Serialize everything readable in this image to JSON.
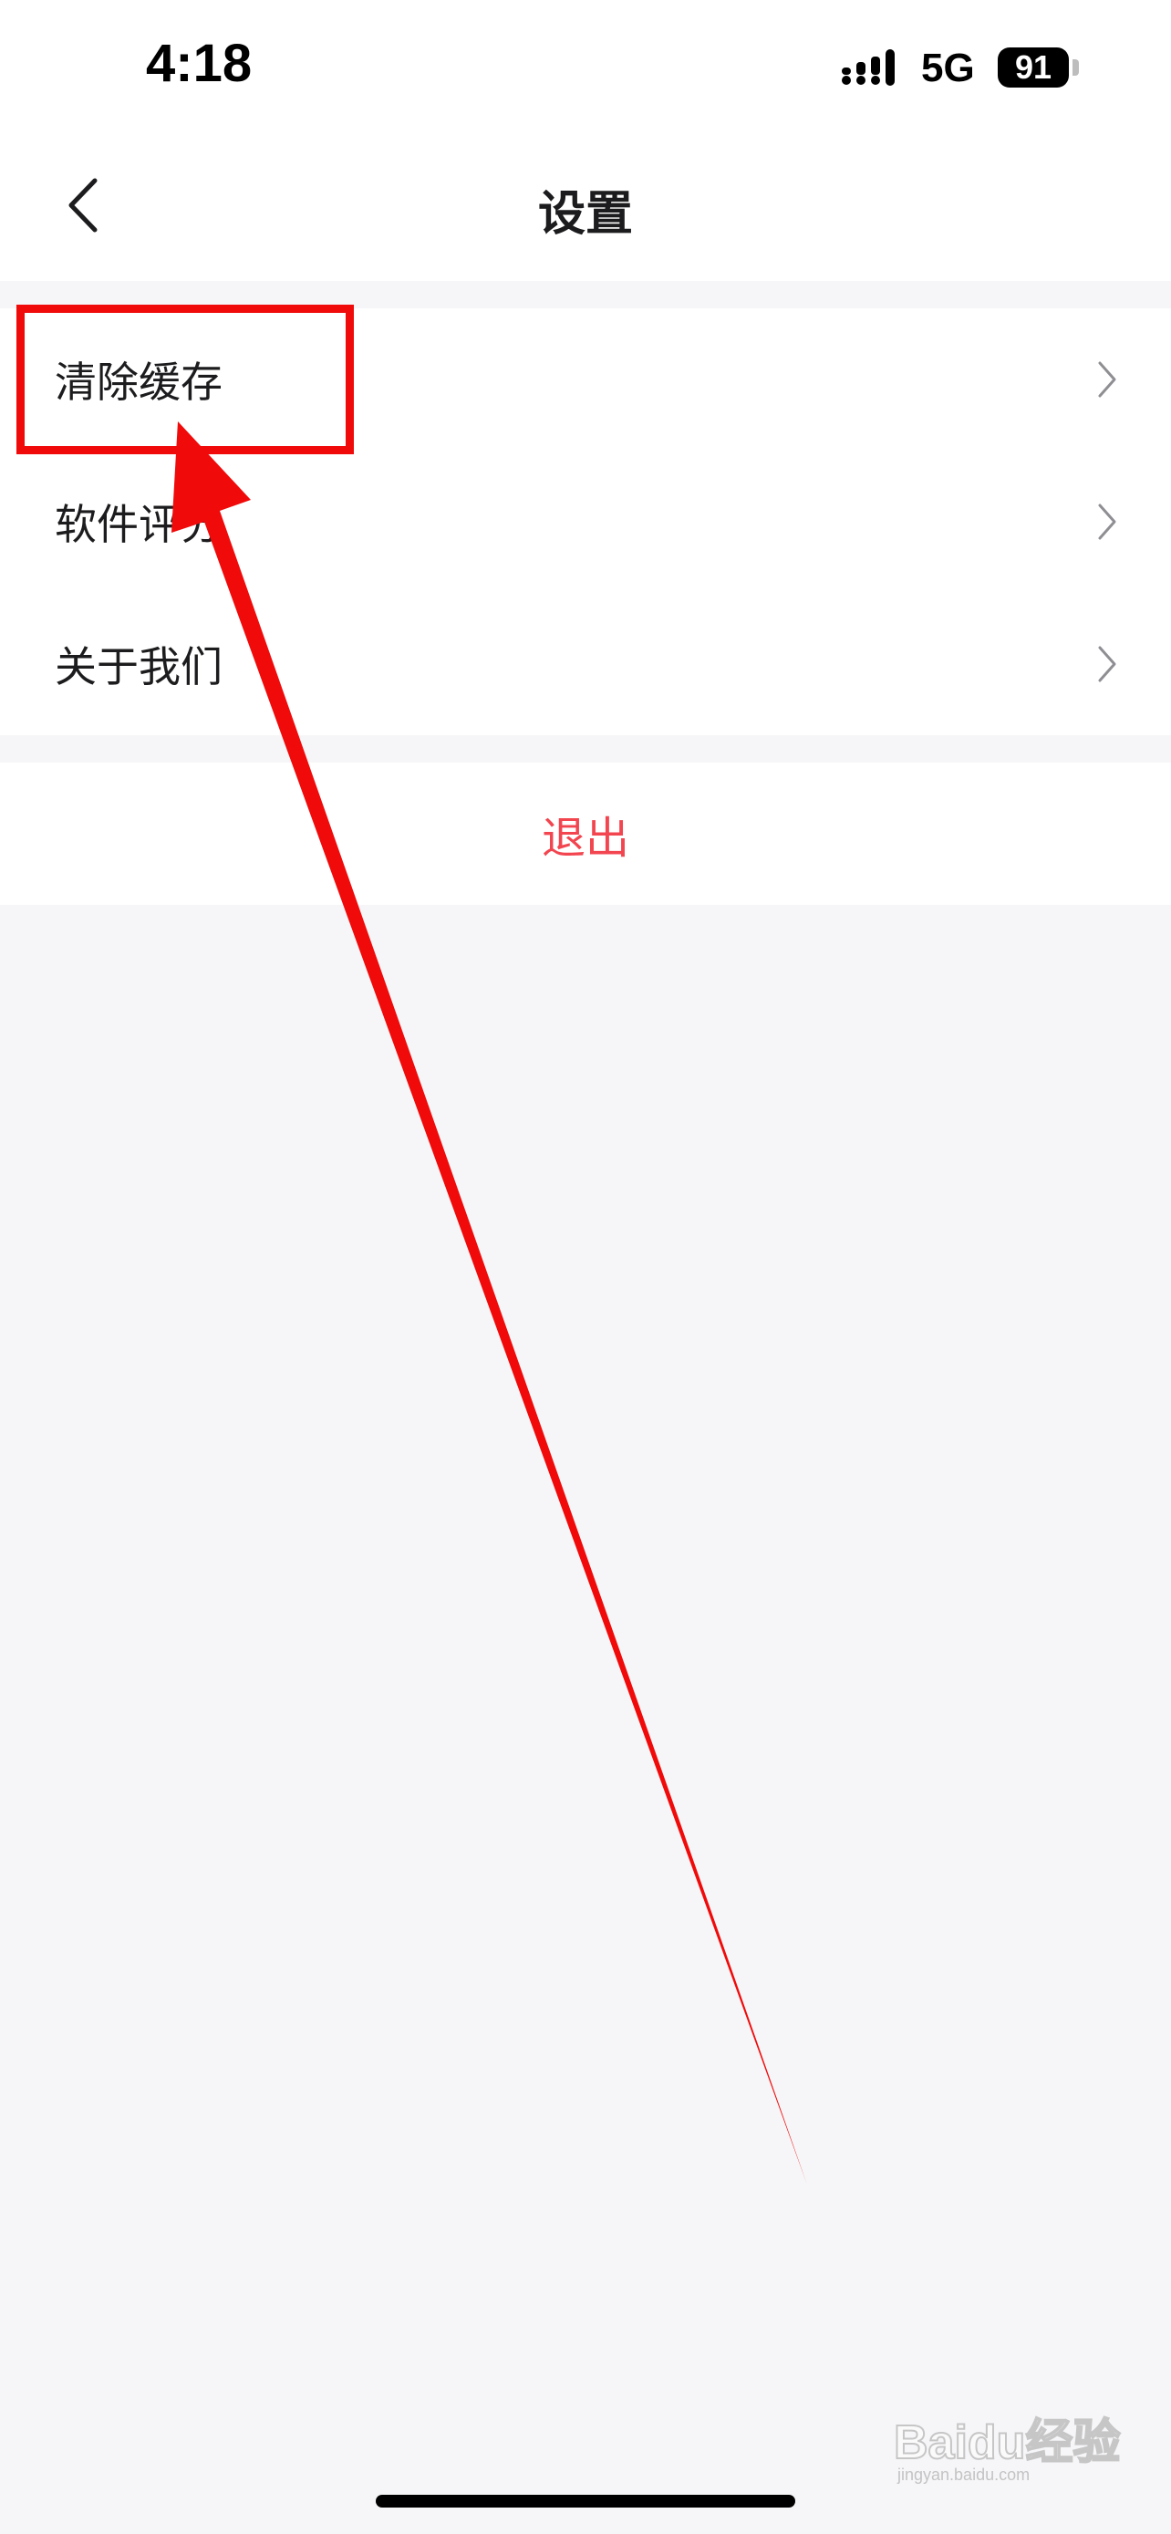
{
  "status_bar": {
    "time": "4:18",
    "network": "5G",
    "battery": "91",
    "signal_icon": "cellular-signal-icon"
  },
  "nav": {
    "back_icon": "chevron-left-icon",
    "title": "设置"
  },
  "settings": {
    "items": [
      {
        "label": "清除缓存",
        "icon": "chevron-right-icon"
      },
      {
        "label": "软件评分",
        "icon": "chevron-right-icon"
      },
      {
        "label": "关于我们",
        "icon": "chevron-right-icon"
      }
    ]
  },
  "logout": {
    "label": "退出",
    "color": "#f2454f"
  },
  "annotation": {
    "color": "#f00a0a"
  },
  "watermark": {
    "brand": "Baidu经验",
    "sub": "jingyan.baidu.com"
  },
  "colors": {
    "background": "#f6f6f8",
    "surface": "#ffffff",
    "text": "#1c1c1e"
  }
}
